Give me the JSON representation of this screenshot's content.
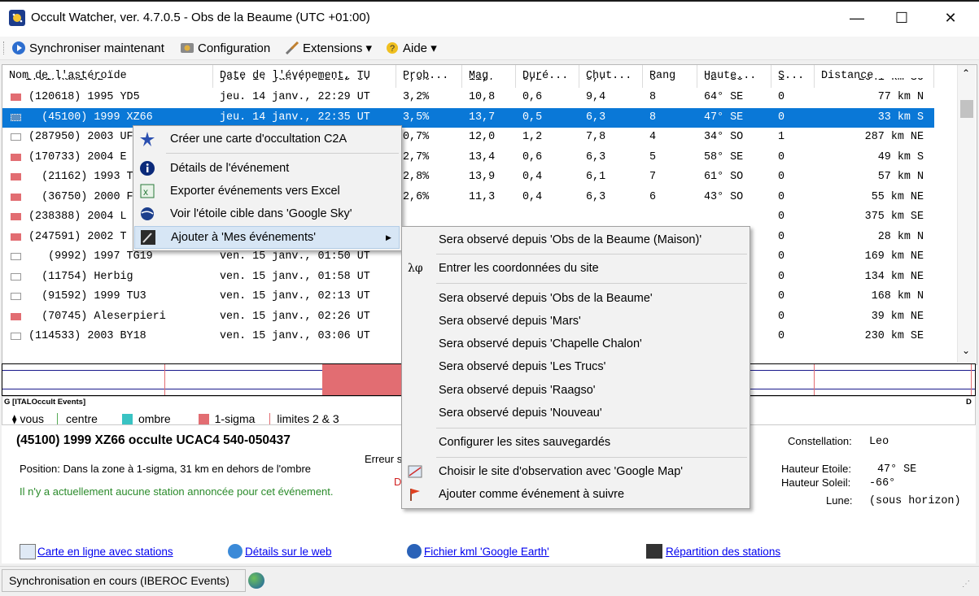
{
  "window": {
    "title": "Occult Watcher, ver. 4.7.0.5 - Obs de la Beaume (UTC +01:00)",
    "minimize": "—",
    "maximize": "☐",
    "close": "✕"
  },
  "toolbar": {
    "sync": "Synchroniser maintenant",
    "config": "Configuration",
    "extensions": "Extensions ▾",
    "help": "Aide ▾"
  },
  "columns": [
    "Nom de l'astéroïde",
    "Date de l'événement, TU",
    "Prob...",
    "Mag",
    "Duré...",
    "Chut...",
    "Rang",
    "Haute...",
    "S...",
    "Distance"
  ],
  "partial_row": [
    "1761/Ramirez",
    "jeu. 14 janv., 22:20 UT",
    "0,0%",
    "11,7",
    "0,2",
    "9,7",
    "6",
    "62° SO",
    "1",
    "2041 km SO"
  ],
  "rows": [
    {
      "mark": "red",
      "cells": [
        "(120618) 1995 YD5",
        "jeu. 14 janv., 22:29 UT",
        "3,2%",
        "10,8",
        "0,6",
        "9,4",
        "8",
        "64° SE",
        "0",
        "77 km N"
      ]
    },
    {
      "mark": "sel",
      "cells": [
        "  (45100) 1999 XZ66",
        "jeu. 14 janv., 22:35 UT",
        "3,5%",
        "13,7",
        "0,5",
        "6,3",
        "8",
        "47° SE",
        "0",
        "33 km S"
      ]
    },
    {
      "mark": "white",
      "cells": [
        "(287950) 2003 UF",
        "",
        "0,7%",
        "12,0",
        "1,2",
        "7,8",
        "4",
        "34° SO",
        "1",
        "287 km NE"
      ]
    },
    {
      "mark": "red",
      "cells": [
        "(170733) 2004 E",
        "",
        "2,7%",
        "13,4",
        "0,6",
        "6,3",
        "5",
        "58° SE",
        "0",
        "49 km S"
      ]
    },
    {
      "mark": "red",
      "cells": [
        "  (21162) 1993 T",
        "",
        "2,8%",
        "13,9",
        "0,4",
        "6,1",
        "7",
        "61° SO",
        "0",
        "57 km N"
      ]
    },
    {
      "mark": "red",
      "cells": [
        "  (36750) 2000 F",
        "",
        "2,6%",
        "11,3",
        "0,4",
        "6,3",
        "6",
        "43° SO",
        "0",
        "55 km NE"
      ]
    },
    {
      "mark": "red",
      "cells": [
        "(238388) 2004 L",
        "",
        "",
        "",
        "",
        "",
        "",
        "",
        "0",
        "375 km SE"
      ]
    },
    {
      "mark": "red",
      "cells": [
        "(247591) 2002 T",
        "",
        "",
        "",
        "",
        "",
        "",
        "",
        "0",
        "28 km N"
      ]
    },
    {
      "mark": "white",
      "cells": [
        "   (9992) 1997 TG19",
        "ven. 15 janv., 01:50 UT",
        "",
        "",
        "",
        "",
        "",
        "",
        "0",
        "169 km NE"
      ]
    },
    {
      "mark": "white",
      "cells": [
        "  (11754) Herbig",
        "ven. 15 janv., 01:58 UT",
        "",
        "",
        "",
        "",
        "",
        "",
        "0",
        "134 km NE"
      ]
    },
    {
      "mark": "white",
      "cells": [
        "  (91592) 1999 TU3",
        "ven. 15 janv., 02:13 UT",
        "",
        "",
        "",
        "",
        "",
        "",
        "0",
        "168 km N"
      ]
    },
    {
      "mark": "red",
      "cells": [
        "  (70745) Aleserpieri",
        "ven. 15 janv., 02:26 UT",
        "",
        "",
        "",
        "",
        "",
        "",
        "0",
        "39 km NE"
      ]
    },
    {
      "mark": "white",
      "cells": [
        "(114533) 2003 BY18",
        "ven. 15 janv., 03:06 UT",
        "",
        "",
        "",
        "",
        "",
        "",
        "0",
        "230 km SE"
      ]
    }
  ],
  "timeline": {
    "source": "G [ITALOccult Events]",
    "right_letter": "D",
    "legend": [
      "vous",
      "centre",
      "ombre",
      "1-sigma",
      "limites 2 & 3"
    ]
  },
  "details": {
    "heading": "(45100) 1999 XZ66 occulte UCAC4 540-050437",
    "position": "Position:  Dans la zone à 1-sigma, 31 km en dehors de l'ombre",
    "stations": "Il n'y a actuellement aucune station annoncée pour cet événement.",
    "erreur": "Erreur s",
    "erreur_d": "D",
    "constellation_label": "Constellation:",
    "constellation_value": "Leo",
    "star_height_label": "Hauteur Etoile:",
    "star_height_value": "47° SE",
    "sun_height_label": "Hauteur Soleil:",
    "sun_height_value": "-66°",
    "moon_label": "Lune:",
    "moon_value": "(sous horizon)",
    "links": [
      "Carte en ligne avec stations",
      "Détails sur le web",
      "Fichier kml 'Google Earth'",
      "Répartition des stations"
    ]
  },
  "status": "Synchronisation en cours (IBEROC Events)",
  "context_menu": [
    "Créer une carte d'occultation C2A",
    "Détails de l'événement",
    "Exporter événements vers Excel",
    "Voir l'étoile cible dans 'Google Sky'",
    "Ajouter à 'Mes événements'"
  ],
  "submenu": [
    "Sera observé depuis 'Obs de la Beaume (Maison)'",
    "Entrer les coordonnées du site",
    "Sera observé depuis 'Obs de la Beaume'",
    "Sera observé depuis 'Mars'",
    "Sera observé depuis 'Chapelle Chalon'",
    "Sera observé depuis 'Les Trucs'",
    "Sera observé depuis 'Raagso'",
    "Sera observé depuis 'Nouveau'",
    "Configurer les sites sauvegardés",
    "Choisir le site d'observation avec 'Google Map'",
    "Ajouter comme événement à suivre"
  ],
  "submenu_coord_icon": "λφ",
  "colors": {
    "selection": "#0a78d7",
    "sigma": "#e26d72",
    "ombre": "#39c3c3",
    "link": "#0000ee"
  }
}
